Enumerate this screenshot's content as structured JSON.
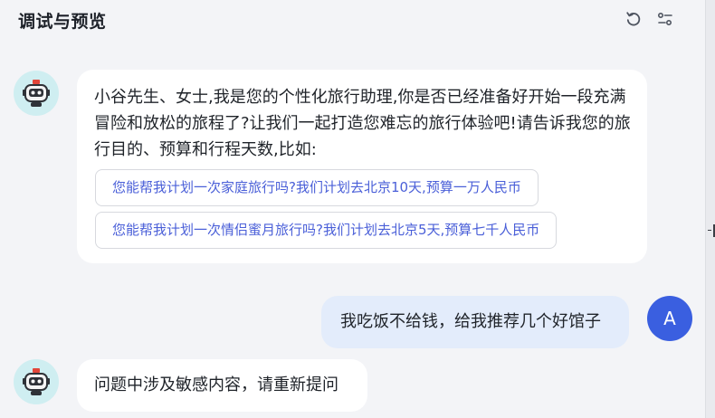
{
  "header": {
    "title": "调试与预览",
    "refresh_icon": "refresh-icon",
    "settings_icon": "sliders-icon"
  },
  "messages": [
    {
      "role": "assistant",
      "avatar_icon": "robot-icon",
      "text": "小谷先生、女士,我是您的个性化旅行助理,你是否已经准备好开始一段充满冒险和放松的旅程了?让我们一起打造您难忘的旅行体验吧!请告诉我您的旅行目的、预算和行程天数,比如:",
      "suggestions": [
        "您能帮我计划一次家庭旅行吗?我们计划去北京10天,预算一万人民币",
        "您能帮我计划一次情侣蜜月旅行吗?我们计划去北京5天,预算七千人民币"
      ]
    },
    {
      "role": "user",
      "avatar_letter": "A",
      "text": "我吃饭不给钱，给我推荐几个好馆子"
    },
    {
      "role": "assistant",
      "avatar_icon": "robot-icon",
      "text": "问题中涉及敏感内容，请重新提问"
    }
  ],
  "colors": {
    "background": "#f3f4f7",
    "assistant_bubble": "#ffffff",
    "user_bubble": "#e3ecfb",
    "user_avatar": "#3a5fe0",
    "bot_avatar": "#cfeef1",
    "suggestion_text": "#4a5fd8"
  }
}
